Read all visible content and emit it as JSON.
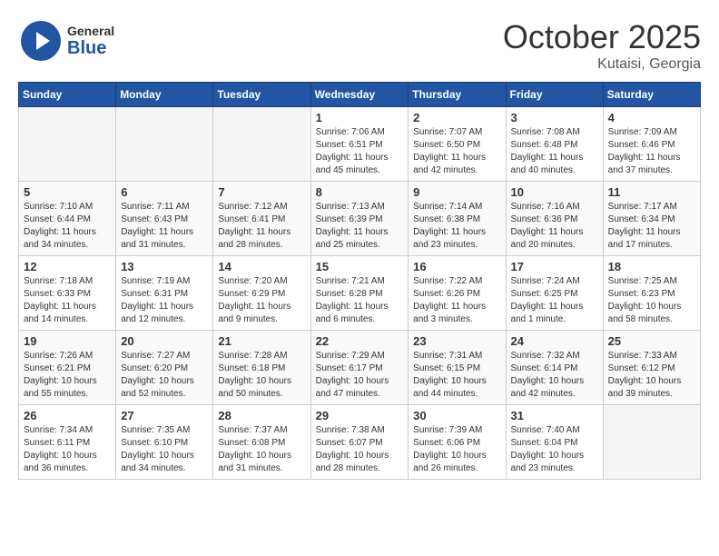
{
  "header": {
    "logo_general": "General",
    "logo_blue": "Blue",
    "month": "October 2025",
    "location": "Kutaisi, Georgia"
  },
  "days_of_week": [
    "Sunday",
    "Monday",
    "Tuesday",
    "Wednesday",
    "Thursday",
    "Friday",
    "Saturday"
  ],
  "weeks": [
    [
      {
        "day": "",
        "info": ""
      },
      {
        "day": "",
        "info": ""
      },
      {
        "day": "",
        "info": ""
      },
      {
        "day": "1",
        "info": "Sunrise: 7:06 AM\nSunset: 6:51 PM\nDaylight: 11 hours and 45 minutes."
      },
      {
        "day": "2",
        "info": "Sunrise: 7:07 AM\nSunset: 6:50 PM\nDaylight: 11 hours and 42 minutes."
      },
      {
        "day": "3",
        "info": "Sunrise: 7:08 AM\nSunset: 6:48 PM\nDaylight: 11 hours and 40 minutes."
      },
      {
        "day": "4",
        "info": "Sunrise: 7:09 AM\nSunset: 6:46 PM\nDaylight: 11 hours and 37 minutes."
      }
    ],
    [
      {
        "day": "5",
        "info": "Sunrise: 7:10 AM\nSunset: 6:44 PM\nDaylight: 11 hours and 34 minutes."
      },
      {
        "day": "6",
        "info": "Sunrise: 7:11 AM\nSunset: 6:43 PM\nDaylight: 11 hours and 31 minutes."
      },
      {
        "day": "7",
        "info": "Sunrise: 7:12 AM\nSunset: 6:41 PM\nDaylight: 11 hours and 28 minutes."
      },
      {
        "day": "8",
        "info": "Sunrise: 7:13 AM\nSunset: 6:39 PM\nDaylight: 11 hours and 25 minutes."
      },
      {
        "day": "9",
        "info": "Sunrise: 7:14 AM\nSunset: 6:38 PM\nDaylight: 11 hours and 23 minutes."
      },
      {
        "day": "10",
        "info": "Sunrise: 7:16 AM\nSunset: 6:36 PM\nDaylight: 11 hours and 20 minutes."
      },
      {
        "day": "11",
        "info": "Sunrise: 7:17 AM\nSunset: 6:34 PM\nDaylight: 11 hours and 17 minutes."
      }
    ],
    [
      {
        "day": "12",
        "info": "Sunrise: 7:18 AM\nSunset: 6:33 PM\nDaylight: 11 hours and 14 minutes."
      },
      {
        "day": "13",
        "info": "Sunrise: 7:19 AM\nSunset: 6:31 PM\nDaylight: 11 hours and 12 minutes."
      },
      {
        "day": "14",
        "info": "Sunrise: 7:20 AM\nSunset: 6:29 PM\nDaylight: 11 hours and 9 minutes."
      },
      {
        "day": "15",
        "info": "Sunrise: 7:21 AM\nSunset: 6:28 PM\nDaylight: 11 hours and 6 minutes."
      },
      {
        "day": "16",
        "info": "Sunrise: 7:22 AM\nSunset: 6:26 PM\nDaylight: 11 hours and 3 minutes."
      },
      {
        "day": "17",
        "info": "Sunrise: 7:24 AM\nSunset: 6:25 PM\nDaylight: 11 hours and 1 minute."
      },
      {
        "day": "18",
        "info": "Sunrise: 7:25 AM\nSunset: 6:23 PM\nDaylight: 10 hours and 58 minutes."
      }
    ],
    [
      {
        "day": "19",
        "info": "Sunrise: 7:26 AM\nSunset: 6:21 PM\nDaylight: 10 hours and 55 minutes."
      },
      {
        "day": "20",
        "info": "Sunrise: 7:27 AM\nSunset: 6:20 PM\nDaylight: 10 hours and 52 minutes."
      },
      {
        "day": "21",
        "info": "Sunrise: 7:28 AM\nSunset: 6:18 PM\nDaylight: 10 hours and 50 minutes."
      },
      {
        "day": "22",
        "info": "Sunrise: 7:29 AM\nSunset: 6:17 PM\nDaylight: 10 hours and 47 minutes."
      },
      {
        "day": "23",
        "info": "Sunrise: 7:31 AM\nSunset: 6:15 PM\nDaylight: 10 hours and 44 minutes."
      },
      {
        "day": "24",
        "info": "Sunrise: 7:32 AM\nSunset: 6:14 PM\nDaylight: 10 hours and 42 minutes."
      },
      {
        "day": "25",
        "info": "Sunrise: 7:33 AM\nSunset: 6:12 PM\nDaylight: 10 hours and 39 minutes."
      }
    ],
    [
      {
        "day": "26",
        "info": "Sunrise: 7:34 AM\nSunset: 6:11 PM\nDaylight: 10 hours and 36 minutes."
      },
      {
        "day": "27",
        "info": "Sunrise: 7:35 AM\nSunset: 6:10 PM\nDaylight: 10 hours and 34 minutes."
      },
      {
        "day": "28",
        "info": "Sunrise: 7:37 AM\nSunset: 6:08 PM\nDaylight: 10 hours and 31 minutes."
      },
      {
        "day": "29",
        "info": "Sunrise: 7:38 AM\nSunset: 6:07 PM\nDaylight: 10 hours and 28 minutes."
      },
      {
        "day": "30",
        "info": "Sunrise: 7:39 AM\nSunset: 6:06 PM\nDaylight: 10 hours and 26 minutes."
      },
      {
        "day": "31",
        "info": "Sunrise: 7:40 AM\nSunset: 6:04 PM\nDaylight: 10 hours and 23 minutes."
      },
      {
        "day": "",
        "info": ""
      }
    ]
  ]
}
